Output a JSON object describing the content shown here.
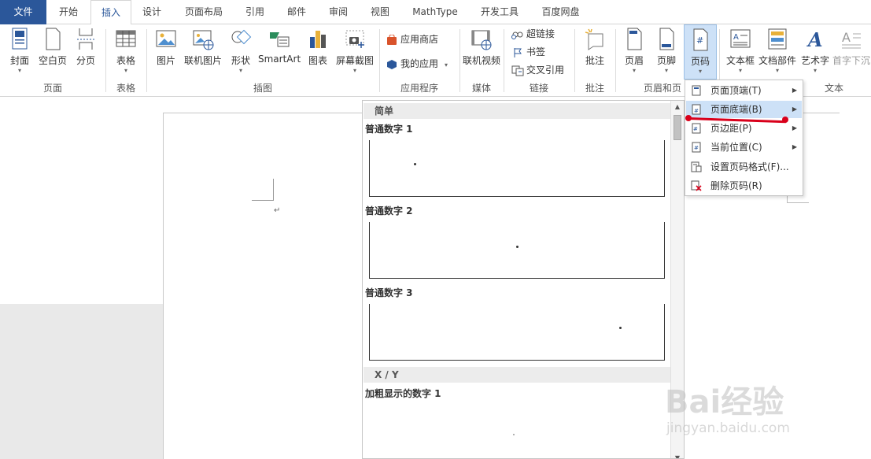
{
  "tabs": [
    "文件",
    "开始",
    "插入",
    "设计",
    "页面布局",
    "引用",
    "邮件",
    "审阅",
    "视图",
    "MathType",
    "开发工具",
    "百度网盘"
  ],
  "ribbon": {
    "page": [
      "封面",
      "空白页",
      "分页"
    ],
    "table": "表格",
    "illustrations": [
      "图片",
      "联机图片",
      "形状",
      "SmartArt",
      "图表",
      "屏幕截图"
    ],
    "apps": [
      "应用商店",
      "我的应用"
    ],
    "media": "联机视频",
    "links": [
      "超链接",
      "书签",
      "交叉引用"
    ],
    "comment": "批注",
    "header_footer": [
      "页眉",
      "页脚",
      "页码"
    ],
    "text": [
      "文本框",
      "文档部件",
      "艺术字",
      "首字下沉"
    ],
    "groups": [
      "页面",
      "表格",
      "插图",
      "应用程序",
      "媒体",
      "链接",
      "批注",
      "页眉和页",
      "文本"
    ]
  },
  "gallery": {
    "sections": [
      "简单",
      "X / Y"
    ],
    "items": [
      "普通数字 1",
      "普通数字 2",
      "普通数字 3",
      "加粗显示的数字 1"
    ]
  },
  "menu": {
    "items": [
      "页面顶端(T)",
      "页面底端(B)",
      "页边距(P)",
      "当前位置(C)",
      "设置页码格式(F)...",
      "删除页码(R)"
    ]
  },
  "watermark": {
    "main": "Bai经验",
    "sub": "jingyan.baidu.com"
  },
  "colors": {
    "accent": "#2b579a",
    "highlight": "#cde1f7",
    "annotation": "#d9001b"
  }
}
